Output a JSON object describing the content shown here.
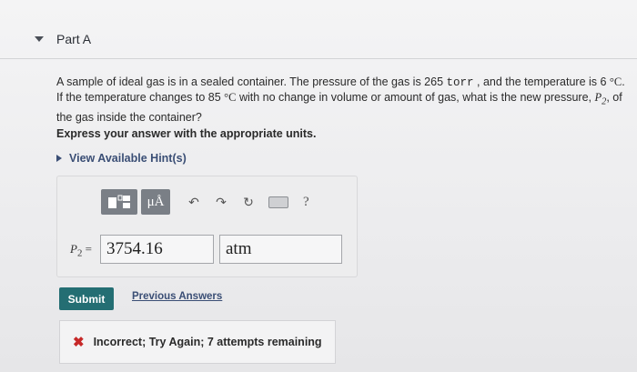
{
  "part": {
    "title": "Part A"
  },
  "question": {
    "p1": "A sample of ideal gas is in a sealed container. The pressure of the gas is 265 ",
    "unit_torr": "torr",
    "p2": " , and the temperature is 6 ",
    "unit_deg1": "°C",
    "p3": ". If the temperature changes to 85 ",
    "unit_deg2": "°C",
    "p4": " with no change in volume or amount of gas, what is the new pressure, ",
    "var_p2": "P",
    "var_p2_sub": "2",
    "p5": ", of the gas inside the container?"
  },
  "instruction": "Express your answer with the appropriate units.",
  "hints_link": "View Available Hint(s)",
  "toolbar": {
    "mu_label": "μÅ",
    "undo_icon": "undo-icon",
    "redo_icon": "redo-icon",
    "reset_icon": "reset-icon",
    "keyboard_icon": "keyboard-icon",
    "help_label": "?"
  },
  "answer": {
    "var_label": "P",
    "var_sub": "2",
    "equals": "=",
    "value": "3754.16",
    "units": "atm"
  },
  "submit_label": "Submit",
  "previous_answers_label": "Previous Answers",
  "feedback": {
    "icon": "x-icon",
    "text": "Incorrect; Try Again; 7 attempts remaining"
  },
  "colors": {
    "submit_bg": "#246e73",
    "link": "#3a4e75",
    "error": "#c62828"
  }
}
